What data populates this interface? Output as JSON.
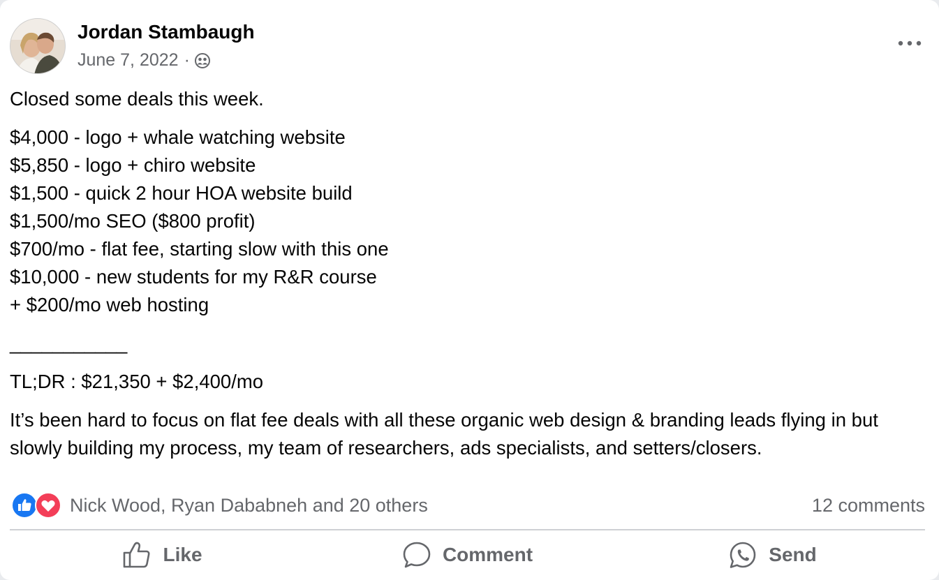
{
  "post": {
    "author": "Jordan Stambaugh",
    "date": "June 7, 2022",
    "separator": "·",
    "audience_icon": "friends-icon",
    "menu_icon": "more-options-icon",
    "lines": {
      "intro": "Closed some deals this week.",
      "deal1": "$4,000 - logo + whale watching website",
      "deal2": "$5,850 - logo + chiro website",
      "deal3": "$1,500 - quick 2 hour HOA website build",
      "deal4": "$1,500/mo SEO ($800 profit)",
      "deal5": "$700/mo - flat fee, starting slow with this one",
      "deal6": "$10,000 - new students for my R&R course",
      "deal7": "+ $200/mo web hosting",
      "rule": "___________",
      "tldr": "TL;DR : $21,350 + $2,400/mo",
      "closing": "It’s been hard to focus on flat fee deals with all these organic web design & branding leads flying in but slowly building my process, my team of researchers, ads specialists, and setters/closers."
    }
  },
  "engagement": {
    "reaction_icons": [
      "like-reaction-icon",
      "love-reaction-icon"
    ],
    "reactors": "Nick Wood, Ryan Dababneh and 20 others",
    "comments": "12 comments"
  },
  "actions": {
    "like": "Like",
    "comment": "Comment",
    "send": "Send"
  },
  "colors": {
    "text_primary": "#050505",
    "text_secondary": "#65676b",
    "like_blue": "#1877f2",
    "love_red": "#f33e58",
    "divider": "#ced0d4"
  }
}
